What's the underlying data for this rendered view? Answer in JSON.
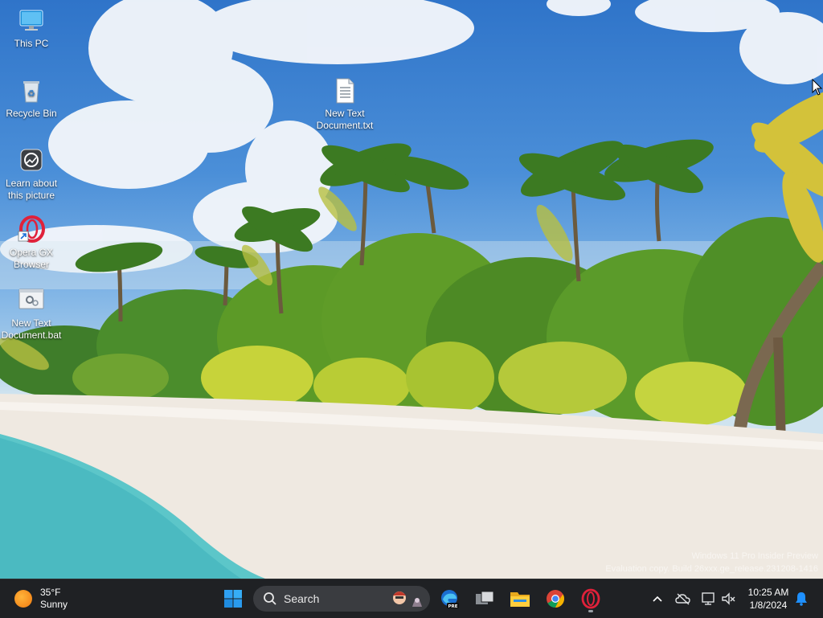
{
  "desktop": {
    "icons": [
      {
        "label": "This PC",
        "icon": "monitor-icon"
      },
      {
        "label": "Recycle Bin",
        "icon": "recycle-bin-icon"
      },
      {
        "label": "Learn about this picture",
        "icon": "camera-icon"
      },
      {
        "label": "Opera GX Browser",
        "icon": "opera-gx-icon"
      },
      {
        "label": "New Text Document.bat",
        "icon": "batch-file-icon"
      },
      {
        "label": "New Text Document.txt",
        "icon": "text-file-icon"
      }
    ],
    "watermark_line1": "Windows 11 Pro Insider Preview",
    "watermark_line2": "Evaluation copy. Build 26xxx.ge_release.231208-1416"
  },
  "taskbar": {
    "weather": {
      "temp": "35°F",
      "condition": "Sunny"
    },
    "search_label": "Search",
    "apps": [
      "windows-start-icon",
      "edge-beta-icon",
      "task-view-icon",
      "file-explorer-icon",
      "chrome-icon",
      "opera-gx-icon"
    ],
    "clock": {
      "time": "10:25 AM",
      "date": "1/8/2024"
    }
  },
  "colors": {
    "taskbar_bg": "#1f2124",
    "accent": "#0a84ff",
    "opera_red": "#e0213a"
  }
}
